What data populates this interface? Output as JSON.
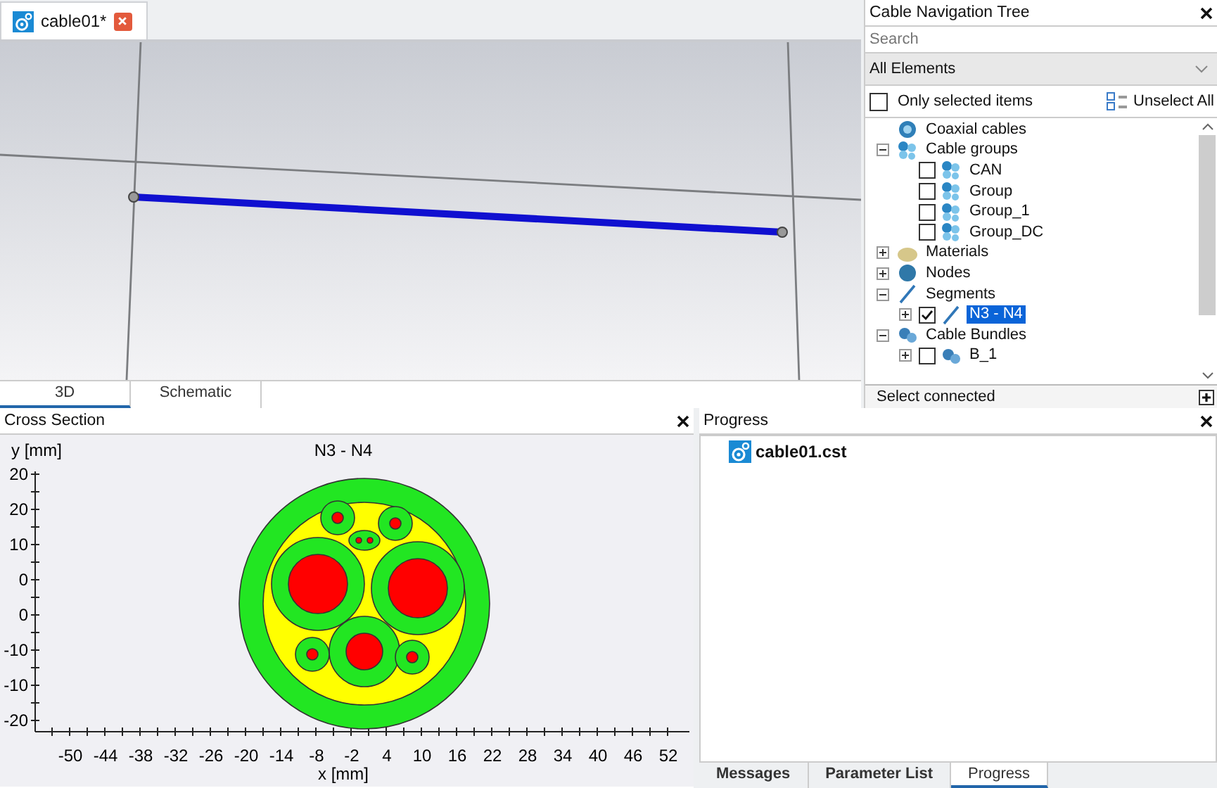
{
  "document_tab": {
    "title": "cable01*"
  },
  "view_tabs": [
    {
      "label": "3D",
      "selected": true
    },
    {
      "label": "Schematic",
      "selected": false
    }
  ],
  "navigation_tree": {
    "title": "Cable Navigation Tree",
    "search": {
      "placeholder": "Search"
    },
    "filter": {
      "value": "All Elements"
    },
    "only_selected": {
      "label": "Only selected items",
      "checked": false
    },
    "unselect_all": "Unselect All",
    "items": [
      {
        "label": "Coaxial cables",
        "kind": "coax"
      },
      {
        "label": "Cable groups",
        "kind": "group",
        "expanded": true,
        "children": [
          {
            "label": "CAN",
            "kind": "group",
            "checked": false,
            "selected": false
          },
          {
            "label": "Group",
            "kind": "group",
            "checked": false,
            "selected": false
          },
          {
            "label": "Group_1",
            "kind": "group",
            "checked": false,
            "selected": false
          },
          {
            "label": "Group_DC",
            "kind": "group",
            "checked": false,
            "selected": false
          }
        ]
      },
      {
        "label": "Materials",
        "kind": "material",
        "expanded": false
      },
      {
        "label": "Nodes",
        "kind": "node",
        "expanded": false
      },
      {
        "label": "Segments",
        "kind": "segment",
        "expanded": true,
        "children": [
          {
            "label": "N3 - N4",
            "kind": "segment",
            "expanded": false,
            "checked": true,
            "selected": true
          }
        ]
      },
      {
        "label": "Cable Bundles",
        "kind": "bundle",
        "expanded": true,
        "children": [
          {
            "label": "B_1",
            "kind": "bundle",
            "expanded": false,
            "checked": false,
            "selected": false
          }
        ]
      }
    ],
    "select_connected": "Select connected"
  },
  "cross_section": {
    "title": "Cross Section",
    "plot_title": "N3 - N4",
    "ylabel": "y [mm]",
    "xlabel": "x [mm]",
    "y_tick_labels": [
      "20",
      "20",
      "10",
      "0",
      "0",
      "-10",
      "-10",
      "-20"
    ],
    "x_tick_labels": [
      "-50",
      "-44",
      "-38",
      "-32",
      "-26",
      "-20",
      "-14",
      "-8",
      "-2",
      "4",
      "10",
      "16",
      "22",
      "28",
      "34",
      "40",
      "46",
      "52"
    ]
  },
  "progress": {
    "title": "Progress",
    "file": "cable01.cst"
  },
  "bottom_tabs": [
    {
      "label": "Messages",
      "selected": false
    },
    {
      "label": "Parameter List",
      "selected": false
    },
    {
      "label": "Progress",
      "selected": true
    }
  ]
}
